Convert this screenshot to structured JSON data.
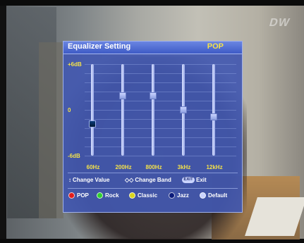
{
  "header": {
    "title": "Equalizer Setting",
    "preset": "POP"
  },
  "logo": {
    "text": "DW"
  },
  "scale": {
    "top": "+6dB",
    "mid": "0",
    "bottom": "-6dB"
  },
  "bands": [
    {
      "label": "60Hz",
      "level": -2
    },
    {
      "label": "200Hz",
      "level": 2
    },
    {
      "label": "800Hz",
      "level": 2
    },
    {
      "label": "3kHz",
      "level": 0
    },
    {
      "label": "12kHz",
      "level": -1
    }
  ],
  "hints": {
    "change_value": "Change Value",
    "change_band": "Change Band",
    "exit_label": "Exit",
    "exit_icon_text": "EXIT"
  },
  "presets": [
    {
      "label": "POP",
      "color": "#e21b1b"
    },
    {
      "label": "Rock",
      "color": "#2fcf2f"
    },
    {
      "label": "Classic",
      "color": "#d9d61c"
    },
    {
      "label": "Jazz",
      "color": "#0a1a7a"
    },
    {
      "label": "Default",
      "color": "#c9d3ff"
    }
  ],
  "colors": {
    "panel": "#4258b0",
    "title_bar": "#4a63d3",
    "accent_yellow": "#f4e24a"
  }
}
